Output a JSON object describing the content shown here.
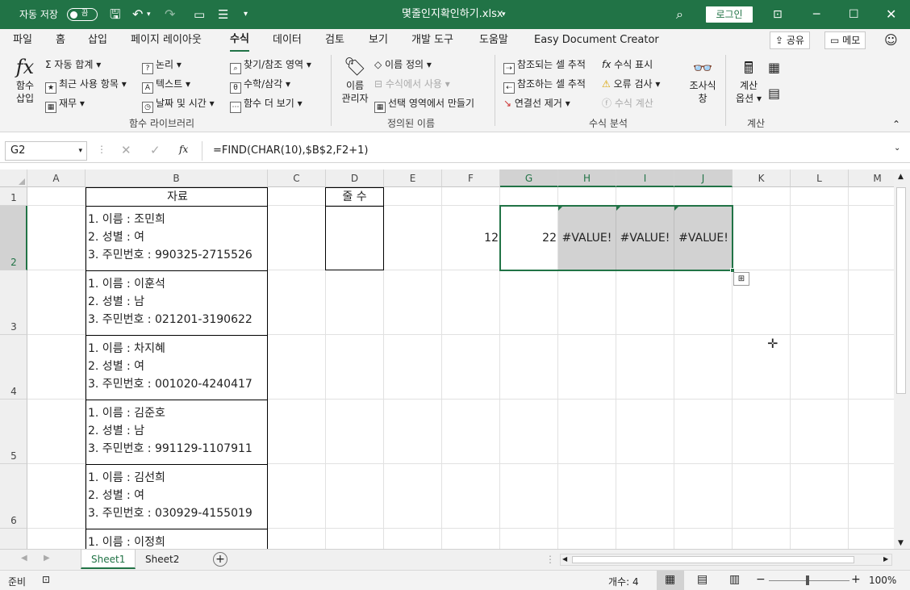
{
  "titlebar": {
    "autosave_label": "자동 저장",
    "autosave_state": "끔",
    "filename": "몇줄인지확인하기.xlsx",
    "login": "로그인"
  },
  "tabs": [
    "파일",
    "홈",
    "삽입",
    "페이지 레이아웃",
    "수식",
    "데이터",
    "검토",
    "보기",
    "개발 도구",
    "도움말",
    "Easy Document Creator"
  ],
  "active_tab": "수식",
  "share_label": "공유",
  "memo_label": "메모",
  "ribbon": {
    "insert_func": [
      "함수",
      "삽입"
    ],
    "autosum": "자동 합계",
    "recent": "최근 사용 항목",
    "finance": "재무",
    "logical": "논리",
    "text": "텍스트",
    "datetime": "날짜 및 시간",
    "lookup": "찾기/참조 영역",
    "math": "수학/삼각",
    "more": "함수 더 보기",
    "group1": "함수 라이브러리",
    "name_mgr": [
      "이름",
      "관리자"
    ],
    "define_name": "이름 정의",
    "use_in_formula": "수식에서 사용",
    "create_from_sel": "선택 영역에서 만들기",
    "group2": "정의된 이름",
    "trace_prec": "참조되는 셀 추적",
    "trace_dep": "참조하는 셀 추적",
    "remove_arrows": "연결선 제거",
    "show_formulas": "수식 표시",
    "error_check": "오류 검사",
    "eval_formula": "수식 계산",
    "watch": [
      "조사식",
      "창"
    ],
    "group3": "수식 분석",
    "calc_options": [
      "계산",
      "옵션"
    ],
    "group4": "계산"
  },
  "formula_bar": {
    "namebox": "G2",
    "formula": "=FIND(CHAR(10),$B$2,F2+1)"
  },
  "columns": [
    "A",
    "B",
    "C",
    "D",
    "E",
    "F",
    "G",
    "H",
    "I",
    "J",
    "K",
    "L",
    "M"
  ],
  "rows": [
    "1",
    "2",
    "3",
    "4",
    "5",
    "6"
  ],
  "cells": {
    "B1": "자료",
    "D1": "줄 수",
    "F2": "12",
    "G2": "22",
    "H2": "#VALUE!",
    "I2": "#VALUE!",
    "J2": "#VALUE!"
  },
  "records": [
    [
      "1. 이름 : 조민희",
      "2. 성별 : 여",
      "3. 주민번호 : 990325-2715526"
    ],
    [
      "1. 이름 : 이훈석",
      "2. 성별 : 남",
      "3. 주민번호 : 021201-3190622"
    ],
    [
      "1. 이름 : 차지혜",
      "2. 성별 : 여",
      "3. 주민번호 : 001020-4240417"
    ],
    [
      "1. 이름 : 김준호",
      "2. 성별 : 남",
      "3. 주민번호 : 991129-1107911"
    ],
    [
      "1. 이름 : 김선희",
      "2. 성별 : 여",
      "3. 주민번호 : 030929-4155019"
    ],
    [
      "1. 이름 : 이정희"
    ]
  ],
  "sheets": [
    "Sheet1",
    "Sheet2"
  ],
  "active_sheet": "Sheet1",
  "status": {
    "ready": "준비",
    "count": "개수: 4",
    "zoom": "100%"
  },
  "colors": {
    "brand": "#217346"
  }
}
